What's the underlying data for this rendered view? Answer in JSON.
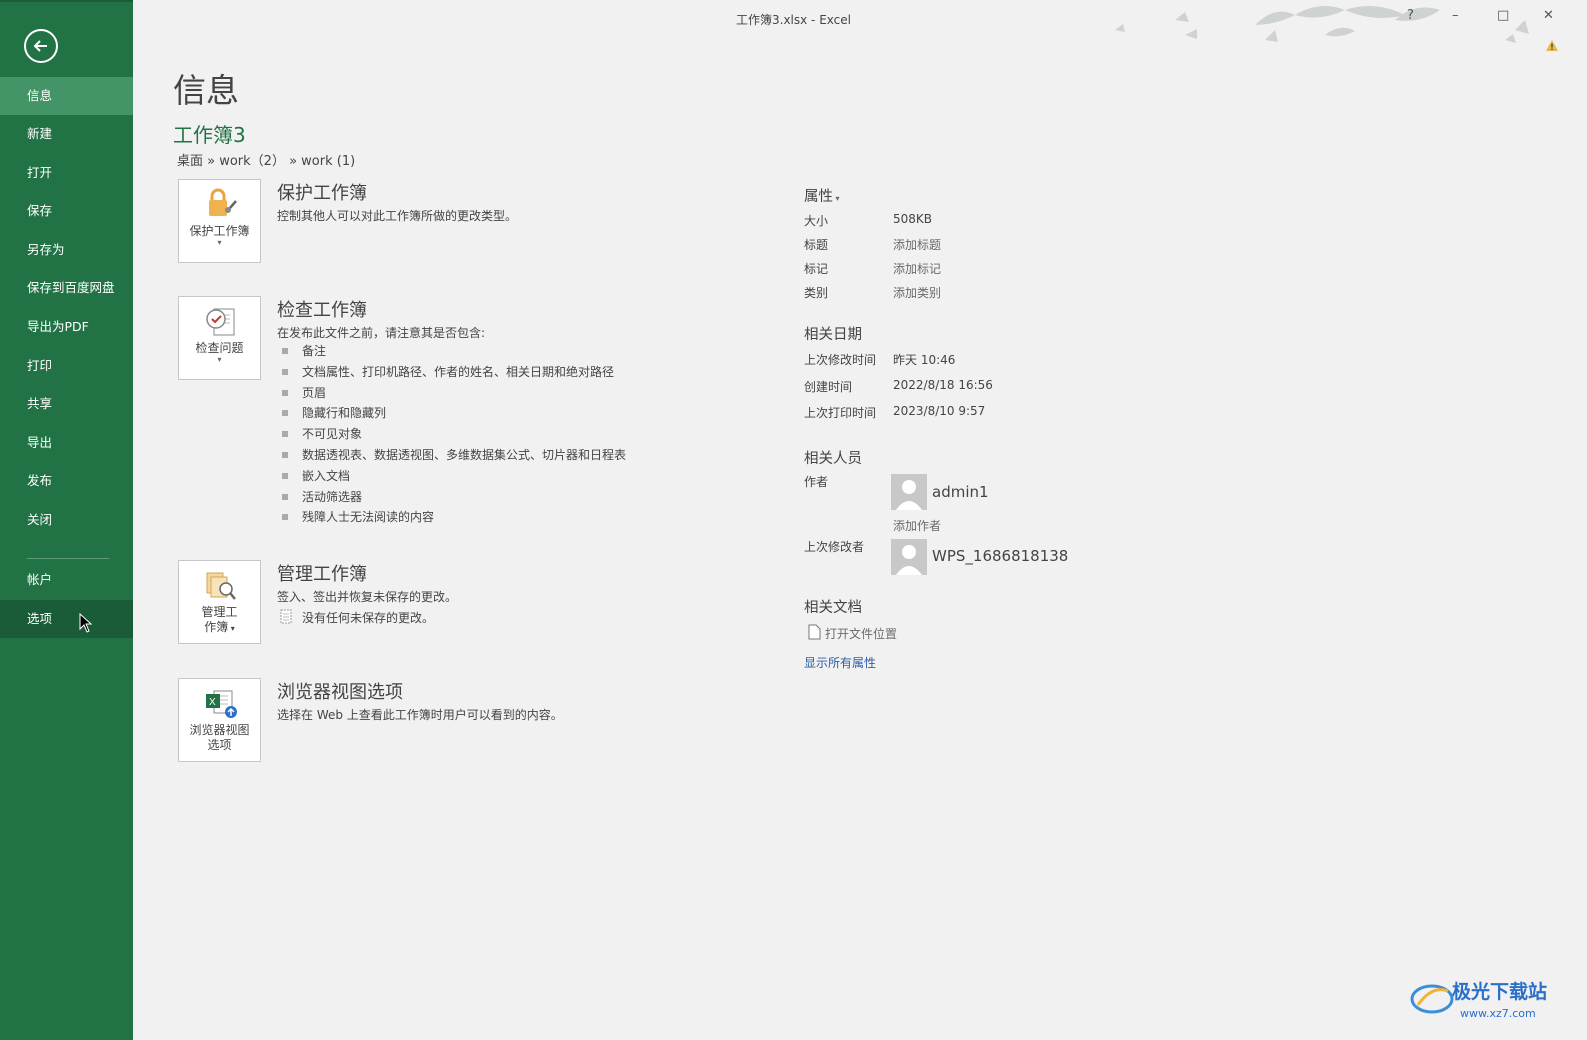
{
  "window": {
    "title": "工作簿3.xlsx - Excel",
    "help": "?",
    "minimize": "–",
    "maximize": "□",
    "close": "✕"
  },
  "sidebar": {
    "items": [
      {
        "label": "信息"
      },
      {
        "label": "新建"
      },
      {
        "label": "打开"
      },
      {
        "label": "保存"
      },
      {
        "label": "另存为"
      },
      {
        "label": "保存到百度网盘"
      },
      {
        "label": "导出为PDF"
      },
      {
        "label": "打印"
      },
      {
        "label": "共享"
      },
      {
        "label": "导出"
      },
      {
        "label": "发布"
      },
      {
        "label": "关闭"
      },
      {
        "label": "帐户"
      },
      {
        "label": "选项"
      }
    ],
    "accent_color": "#217346"
  },
  "main": {
    "heading": "信息",
    "doc_title": "工作簿3",
    "path": "桌面 » work（2） » work (1)",
    "sections": [
      {
        "tile_label": "保护工作簿",
        "title": "保护工作簿",
        "desc": "控制其他人可以对此工作簿所做的更改类型。"
      },
      {
        "tile_label": "检查问题",
        "title": "检查工作簿",
        "desc": "在发布此文件之前，请注意其是否包含:",
        "bullets": [
          "备注",
          "文档属性、打印机路径、作者的姓名、相关日期和绝对路径",
          "页眉",
          "隐藏行和隐藏列",
          "不可见对象",
          "数据透视表、数据透视图、多维数据集公式、切片器和日程表",
          "嵌入文档",
          "活动筛选器",
          "残障人士无法阅读的内容"
        ]
      },
      {
        "tile_label_line1": "管理工",
        "tile_label_line2": "作簿",
        "title": "管理工作簿",
        "desc": "签入、签出并恢复未保存的更改。",
        "note": "没有任何未保存的更改。"
      },
      {
        "tile_label_line1": "浏览器视图",
        "tile_label_line2": "选项",
        "title": "浏览器视图选项",
        "desc": "选择在 Web 上查看此工作簿时用户可以看到的内容。"
      }
    ]
  },
  "properties": {
    "heading": "属性",
    "rows": [
      {
        "label": "大小",
        "value": "508KB"
      },
      {
        "label": "标题",
        "value": "添加标题"
      },
      {
        "label": "标记",
        "value": "添加标记"
      },
      {
        "label": "类别",
        "value": "添加类别"
      }
    ],
    "dates_heading": "相关日期",
    "dates": [
      {
        "label": "上次修改时间",
        "value": "昨天 10:46"
      },
      {
        "label": "创建时间",
        "value": "2022/8/18 16:56"
      },
      {
        "label": "上次打印时间",
        "value": "2023/8/10 9:57"
      }
    ],
    "people_heading": "相关人员",
    "author_label": "作者",
    "author_name": "admin1",
    "add_author": "添加作者",
    "last_modified_by_label": "上次修改者",
    "last_modified_by_name": "WPS_1686818138",
    "docs_heading": "相关文档",
    "open_location": "打开文件位置",
    "show_all": "显示所有属性"
  },
  "watermark": {
    "text": "极光下载站",
    "url": "www.xz7.com"
  }
}
